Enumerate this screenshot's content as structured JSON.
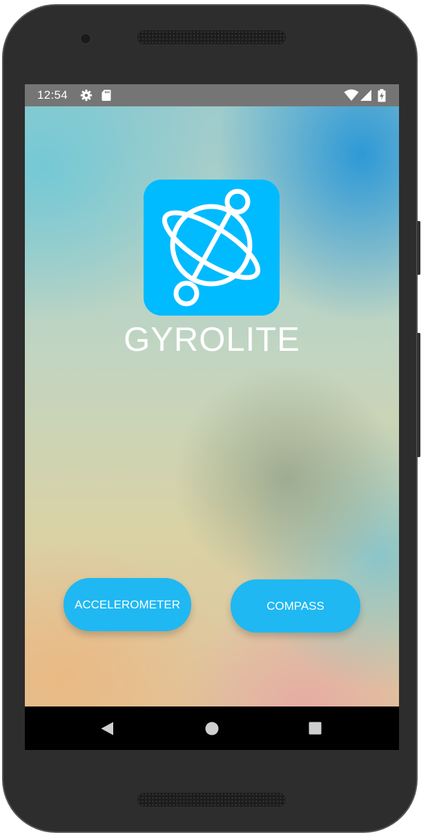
{
  "status_bar": {
    "time": "12:54",
    "icons": [
      "gear-icon",
      "sd-card-icon",
      "wifi-icon",
      "signal-icon",
      "battery-charging-icon"
    ]
  },
  "app": {
    "title": "GYROLITE",
    "logo_icon": "gyroscope-orbit-icon",
    "buttons": {
      "accelerometer": "ACCELEROMETER",
      "compass": "COMPASS"
    }
  },
  "nav_bar": {
    "icons": [
      "back-triangle-icon",
      "home-circle-icon",
      "recents-square-icon"
    ]
  },
  "colors": {
    "logo_background": "#00bbff",
    "button_background": "#1fb8f3",
    "status_bar": "#757575",
    "nav_bar": "#000000"
  }
}
